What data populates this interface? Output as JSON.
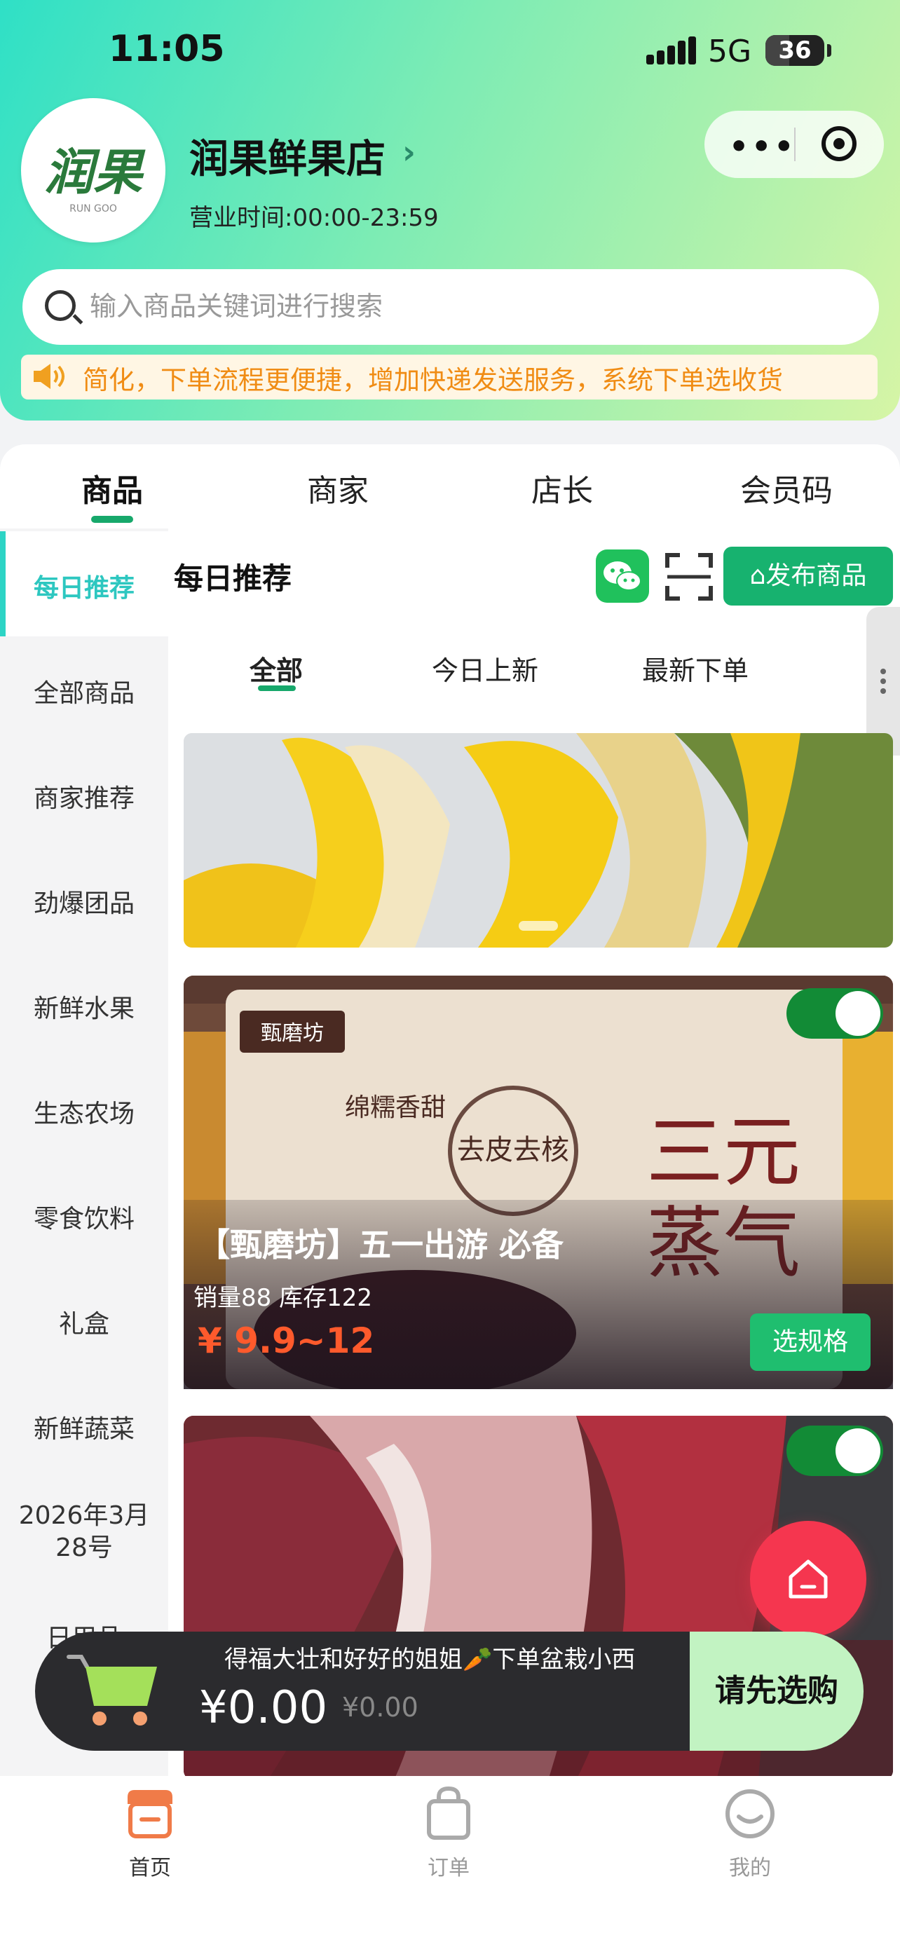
{
  "status_bar": {
    "time": "11:05",
    "network": "5G",
    "battery": "36"
  },
  "store": {
    "logo_text": "润果",
    "logo_sub": "RUN GOO",
    "name": "润果鲜果店",
    "arrow": "›",
    "hours": "营业时间:00:00-23:59"
  },
  "capsule": {
    "more": "•••"
  },
  "search": {
    "placeholder": "输入商品关键词进行搜索"
  },
  "notice": {
    "text": "简化，下单流程更便捷，增加快递发送服务，系统下单选收货"
  },
  "tabs": [
    "商品",
    "商家",
    "店长",
    "会员码"
  ],
  "sidebar": {
    "items": [
      "每日推荐",
      "全部商品",
      "商家推荐",
      "劲爆团品",
      "新鲜水果",
      "生态农场",
      "零食饮料",
      "礼盒",
      "新鲜蔬菜",
      "2026年3月28号",
      "日用品"
    ]
  },
  "section": {
    "title": "每日推荐",
    "publish_label": "发布商品",
    "sub_tabs": [
      "全部",
      "今日上新",
      "最新下单"
    ]
  },
  "products": [
    {
      "title": "【甄磨坊】五一出游 必备",
      "meta": "销量88 库存122",
      "price": "¥ 9.9~12",
      "button": "选规格",
      "enabled": true
    },
    {
      "enabled": true
    }
  ],
  "cart": {
    "marquee": "得福大壮和好好的姐姐🥕下单盆栽小西",
    "price": "¥0.00",
    "original_price": "¥0.00",
    "checkout_label": "请先选购"
  },
  "bottom_nav": [
    {
      "label": "首页",
      "icon": "store-icon"
    },
    {
      "label": "订单",
      "icon": "bag-icon"
    },
    {
      "label": "我的",
      "icon": "smile-icon"
    }
  ],
  "colors": {
    "brand_green": "#17b26f",
    "accent_teal": "#2dd4c5",
    "price_red": "#ff5a2c",
    "fab_red": "#f5364f",
    "notice_orange": "#f08c14",
    "active_nav": "#f07b48"
  }
}
